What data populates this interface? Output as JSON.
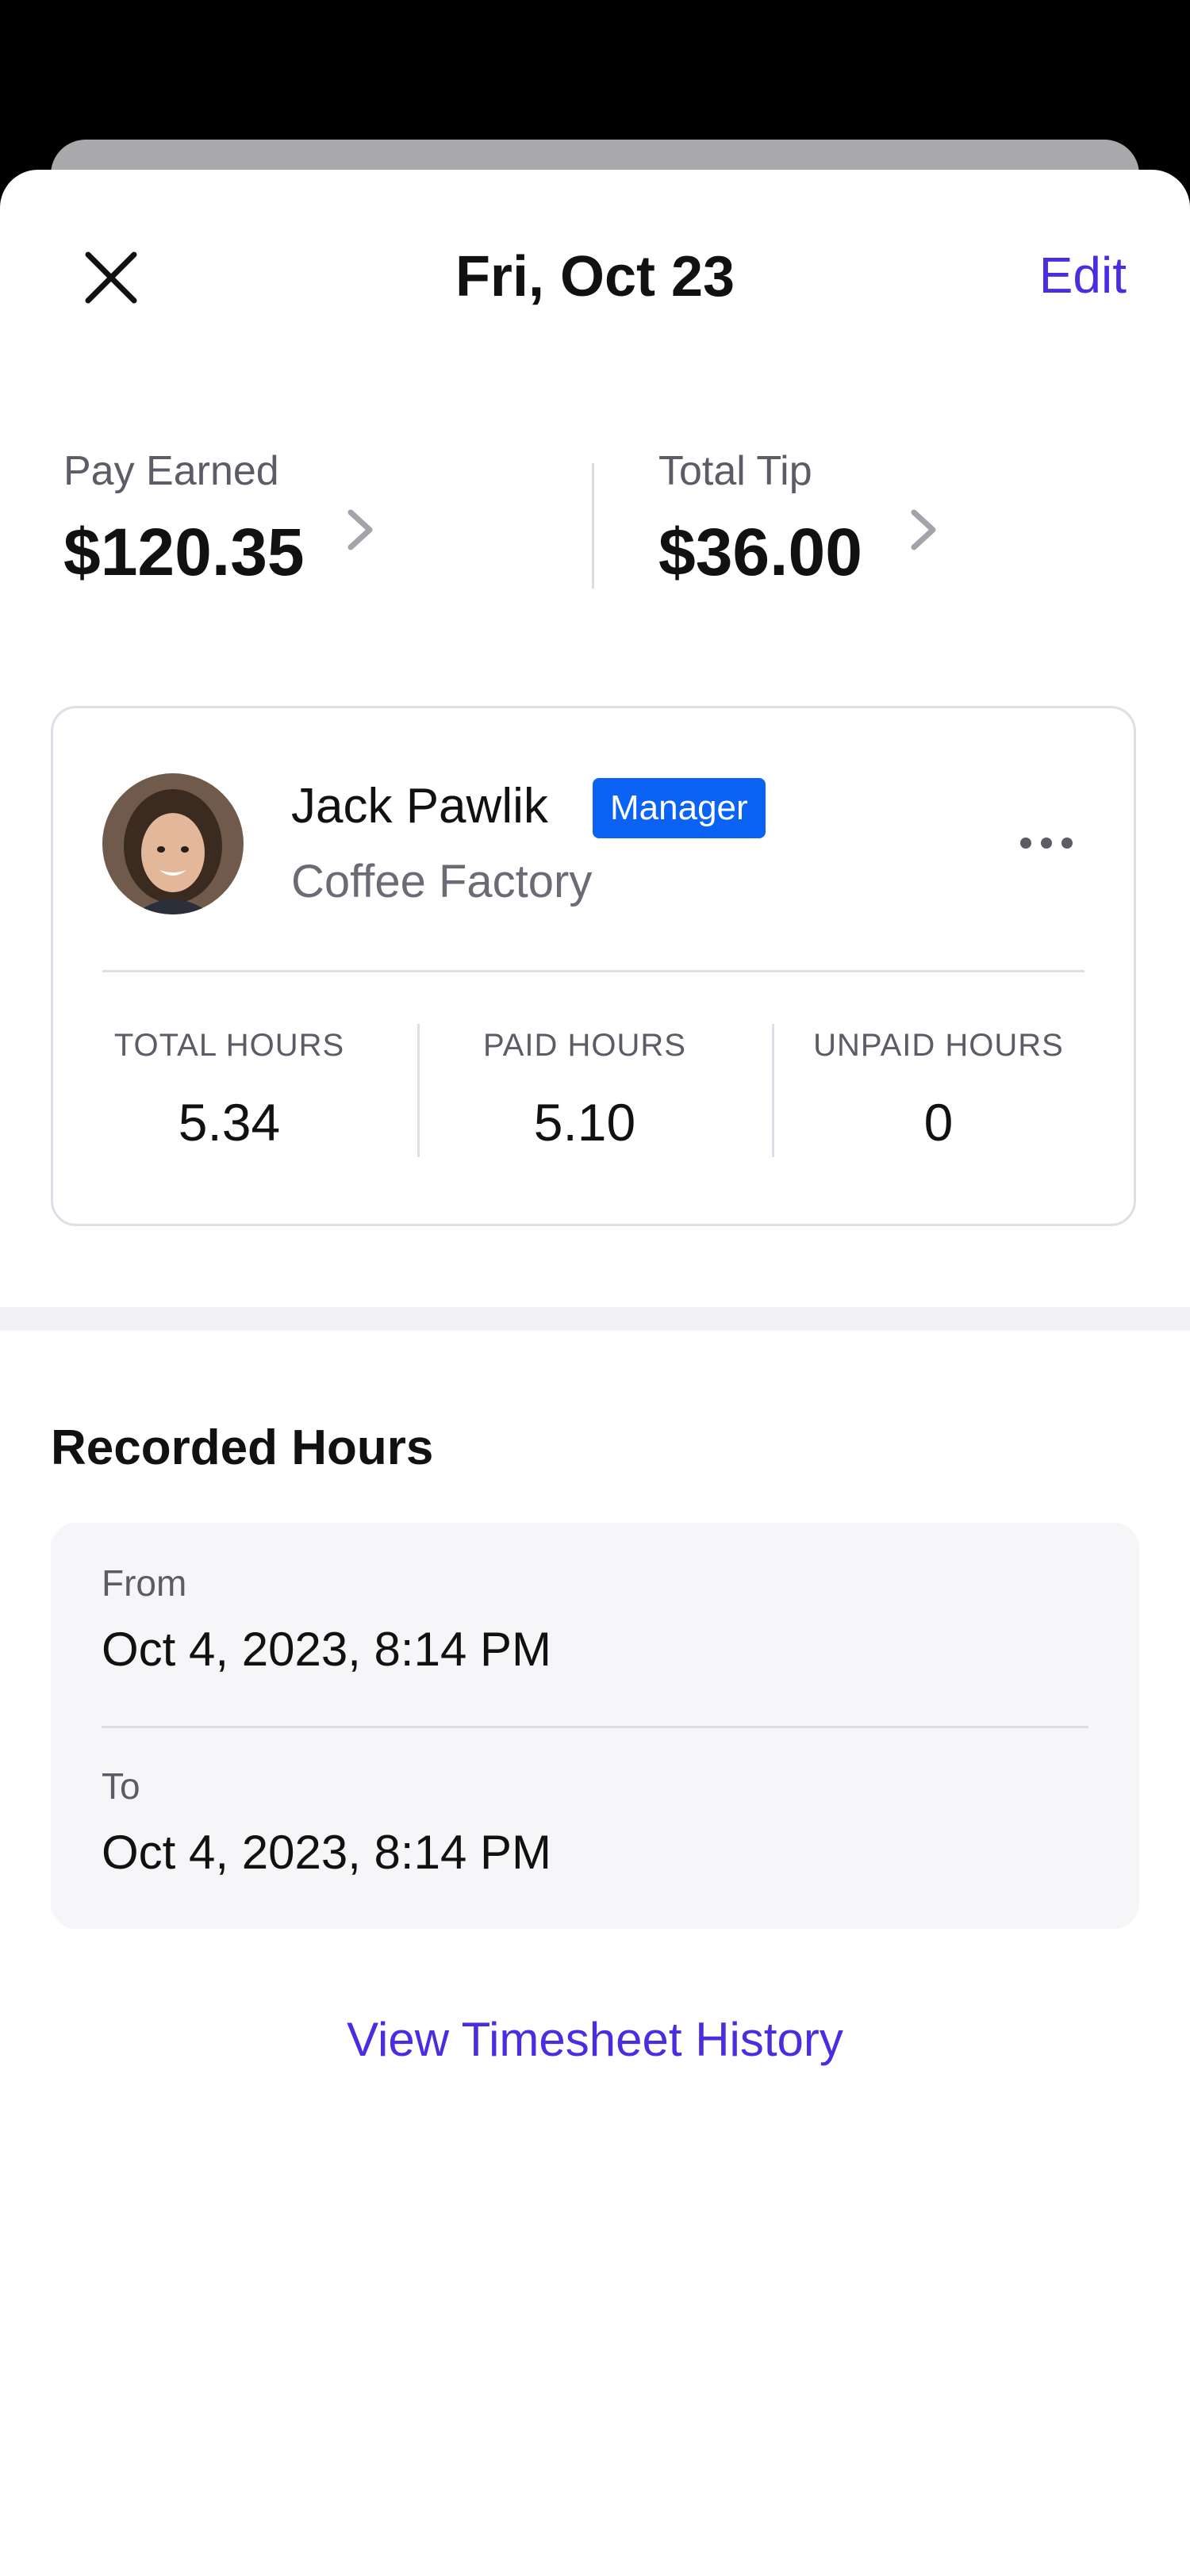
{
  "header": {
    "title": "Fri, Oct 23",
    "edit_label": "Edit",
    "close_icon": "close-icon",
    "accent_color": "#4a2de0"
  },
  "summary": {
    "pay_earned": {
      "label": "Pay Earned",
      "value": "$120.35",
      "icon": "chevron-right-icon"
    },
    "total_tip": {
      "label": "Total Tip",
      "value": "$36.00",
      "icon": "chevron-right-icon"
    }
  },
  "employee": {
    "name": "Jack Pawlik",
    "role": "Manager",
    "role_color": "#0b63f5",
    "company": "Coffee Factory",
    "more_icon": "more-horizontal-icon",
    "stats": [
      {
        "label": "TOTAL HOURS",
        "value": "5.34"
      },
      {
        "label": "PAID HOURS",
        "value": "5.10"
      },
      {
        "label": "UNPAID HOURS",
        "value": "0"
      }
    ]
  },
  "recorded_hours": {
    "title": "Recorded Hours",
    "from": {
      "label": "From",
      "value": "Oct 4, 2023, 8:14 PM"
    },
    "to": {
      "label": "To",
      "value": "Oct 4, 2023, 8:14 PM"
    }
  },
  "history_link": "View Timesheet History"
}
